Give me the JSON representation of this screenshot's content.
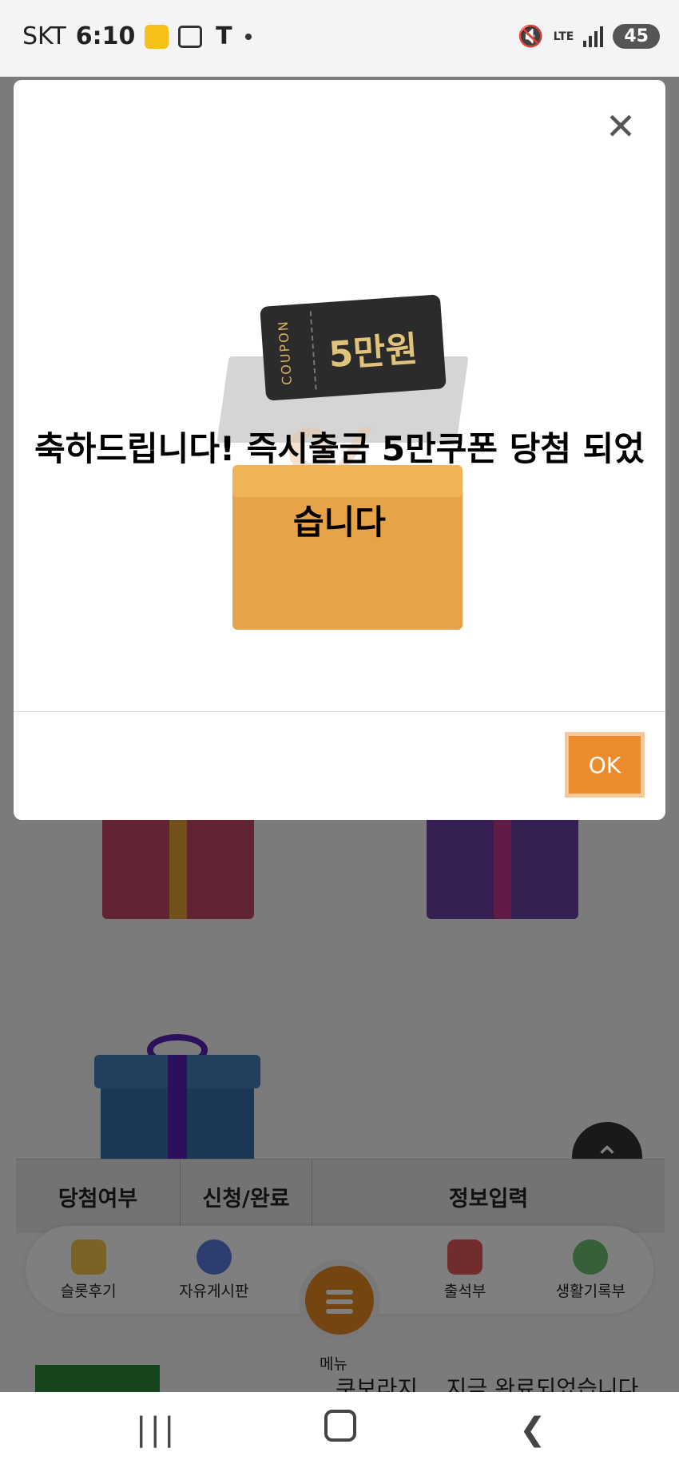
{
  "status_bar": {
    "carrier": "SKT",
    "time": "6:10",
    "network": "LTE",
    "battery": "45"
  },
  "modal": {
    "coupon_side_text": "COUPON",
    "coupon_value": "5만원",
    "message": "축하드립니다! 즉시출금 5만쿠폰 당첨 되었습니다",
    "ok_label": "OK"
  },
  "tabs": [
    "당첨여부",
    "신청/완료",
    "정보입력"
  ],
  "bottom_nav": {
    "items": [
      {
        "label": "슬롯후기",
        "icon": "pencil-note-icon",
        "color": "#f2c94c"
      },
      {
        "label": "자유게시판",
        "icon": "chat-bubbles-icon",
        "color": "#5d7be0"
      },
      {
        "label": "메뉴",
        "icon": "menu-icon",
        "color": "#e88a22"
      },
      {
        "label": "출석부",
        "icon": "calendar-icon",
        "color": "#e35b5b"
      },
      {
        "label": "생활기록부",
        "icon": "emoji-faces-icon",
        "color": "#6fbf73"
      }
    ]
  },
  "page_peek_text": "쿠보라지... 지금 완료되었습니다",
  "colors": {
    "accent": "#ec8b2c",
    "overlay": "rgba(0,0,0,0.5)"
  }
}
